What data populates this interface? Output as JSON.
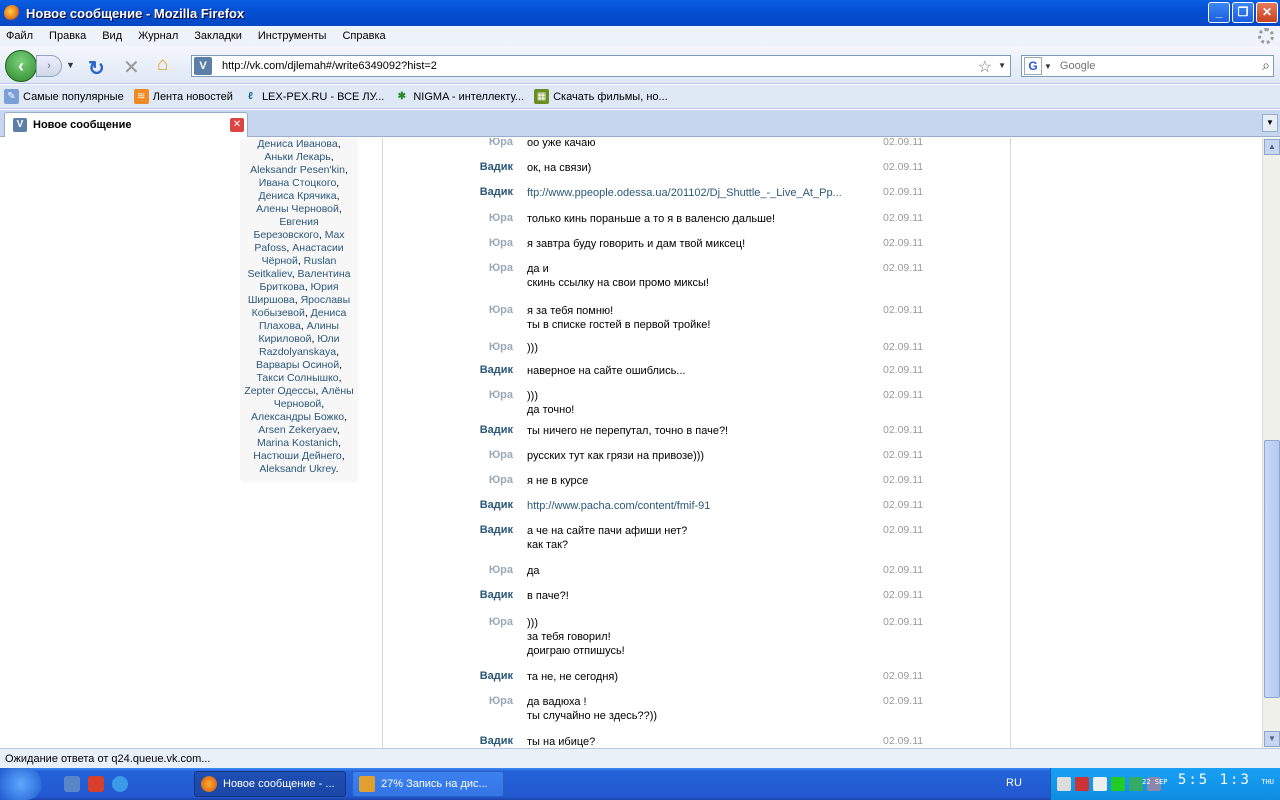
{
  "window": {
    "title": "Новое сообщение - Mozilla Firefox"
  },
  "menu": [
    "Файл",
    "Правка",
    "Вид",
    "Журнал",
    "Закладки",
    "Инструменты",
    "Справка"
  ],
  "nav": {
    "url": "http://vk.com/djlemah#/write6349092?hist=2",
    "search_placeholder": "Google"
  },
  "bookmarks": [
    {
      "label": "Самые популярные",
      "icon": "most-visited-icon"
    },
    {
      "label": "Лента новостей",
      "icon": "rss-icon"
    },
    {
      "label": "LEX-PEX.RU - ВСЕ ЛУ...",
      "icon": "lexpex-icon"
    },
    {
      "label": "NIGMA - интеллекту...",
      "icon": "nigma-icon"
    },
    {
      "label": "Скачать фильмы, но...",
      "icon": "film-icon"
    }
  ],
  "tab": {
    "label": "Новое сообщение"
  },
  "friends_text": [
    "Дениса Иванова",
    "Аньки Лекарь",
    "Aleksandr Pesen'kin",
    "Ивана Стоцкого",
    "Дениса Крячика",
    "Алены Черновой",
    "Евгения Березовского",
    "Max Pafoss",
    "Анастасии Чёрной",
    "Ruslan Seitkaliev",
    "Валентина Бриткова",
    "Юрия Ширшова",
    "Ярославы Кобызевой",
    "Дениса Плахова",
    "Алины Кириловой",
    "Юли Razdolyanskaya",
    "Варвары Осиной",
    "Такси Солнышко",
    "Zepter Одессы",
    "Алёны Черновой",
    "Александры Божко",
    "Arsen Zekeryaev",
    "Marina Kostanich",
    "Настюши Дейнего",
    "Aleksandr Ukrey"
  ],
  "messages": [
    {
      "who": "Юра",
      "text": "оо уже качаю",
      "date": "02.09.11"
    },
    {
      "who": "Вадик",
      "text": "ок, на связи)",
      "date": "02.09.11"
    },
    {
      "who": "Вадик",
      "text": "ftp://www.ppeople.odessa.ua/201102/Dj_Shuttle_-_Live_At_Pp...",
      "date": "02.09.11"
    },
    {
      "who": "Юра",
      "text": "только кинь пораньше а то я в валенсю дальше!",
      "date": "02.09.11"
    },
    {
      "who": "Юра",
      "text": "я завтра буду говорить и дам твой миксец!",
      "date": "02.09.11"
    },
    {
      "who": "Юра",
      "text": "да и\nскинь ссылку на свои промо миксы!",
      "date": "02.09.11"
    },
    {
      "who": "Юра",
      "text": "я за тебя помню!\nты в списке гостей в первой тройке!",
      "date": "02.09.11"
    },
    {
      "who": "Юра",
      "text": ")))",
      "date": "02.09.11"
    },
    {
      "who": "Вадик",
      "text": "наверное на сайте ошиблись...",
      "date": "02.09.11"
    },
    {
      "who": "Юра",
      "text": ")))\nда точно!",
      "date": "02.09.11"
    },
    {
      "who": "Вадик",
      "text": "ты ничего не перепутал, точно в паче?!",
      "date": "02.09.11"
    },
    {
      "who": "Юра",
      "text": "русских тут как грязи на привозе)))",
      "date": "02.09.11"
    },
    {
      "who": "Юра",
      "text": "я не в курсе",
      "date": "02.09.11"
    },
    {
      "who": "Вадик",
      "text": "http://www.pacha.com/content/fmif-91",
      "date": "02.09.11"
    },
    {
      "who": "Вадик",
      "text": "а че на сайте пачи афиши нет?\nкак так?",
      "date": "02.09.11"
    },
    {
      "who": "Юра",
      "text": "да",
      "date": "02.09.11"
    },
    {
      "who": "Вадик",
      "text": "в паче?!",
      "date": "02.09.11"
    },
    {
      "who": "Юра",
      "text": ")))\nза тебя говорил!\nдоиграю отпишусь!",
      "date": "02.09.11"
    },
    {
      "who": "Вадик",
      "text": "та не, не сегодня)",
      "date": "02.09.11"
    },
    {
      "who": "Юра",
      "text": "да вадюха !\nты случайно не здесь??))",
      "date": "02.09.11"
    },
    {
      "who": "Вадик",
      "text": "ты на ибице?",
      "date": "02.09.11"
    }
  ],
  "status": "Ожидание ответа от q24.queue.vk.com...",
  "taskbar": {
    "tasks": [
      "Новое сообщение - ...",
      "27% Запись на дис..."
    ],
    "lang": "RU",
    "clock": "5:5 1:3",
    "date_small": "22 SEP",
    "day": "THU"
  }
}
